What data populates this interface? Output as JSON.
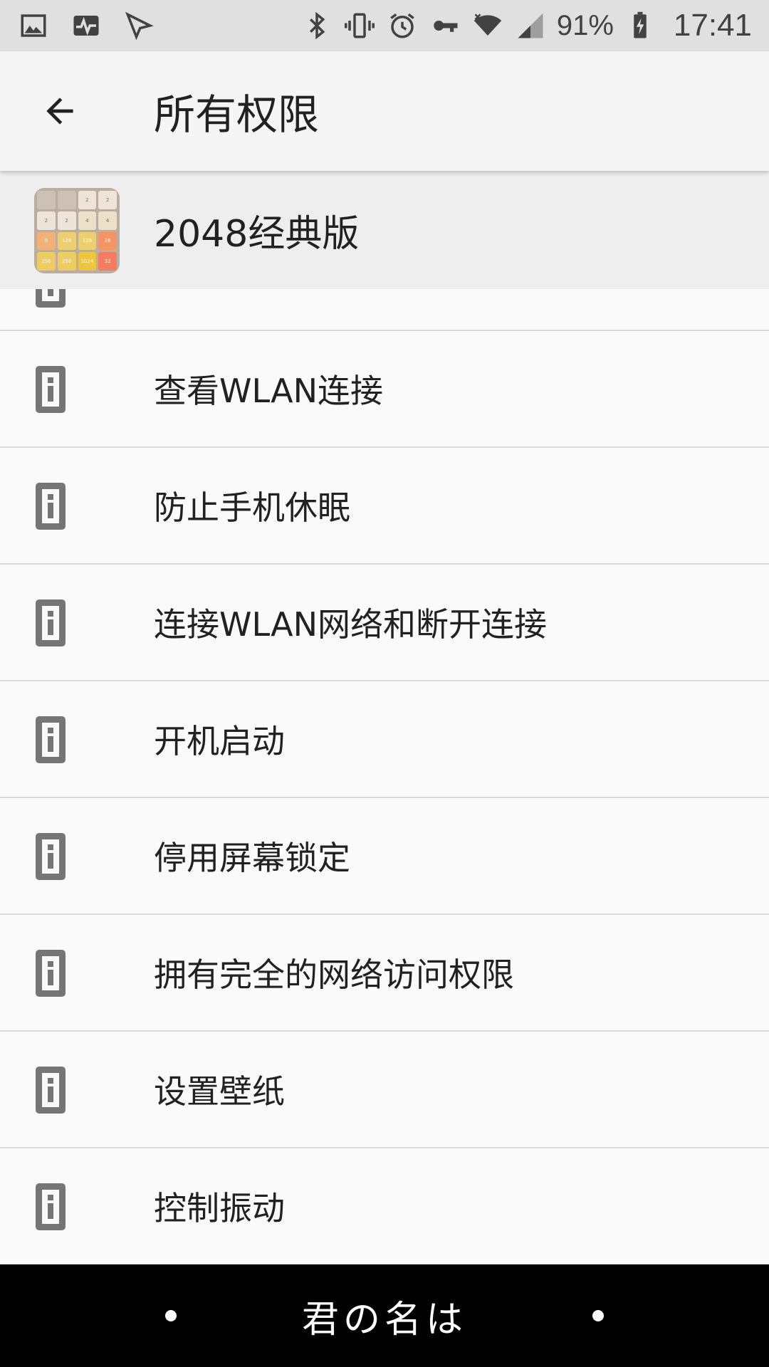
{
  "status_bar": {
    "left_icons": [
      "gallery-icon",
      "activity-icon",
      "send-icon"
    ],
    "right_icons": [
      "bluetooth-icon",
      "vibrate-icon",
      "alarm-icon",
      "vpn-key-icon",
      "wifi-icon",
      "signal-icon"
    ],
    "battery_percent": "91%",
    "time": "17:41"
  },
  "app_bar": {
    "title": "所有权限"
  },
  "app": {
    "name": "2048经典版",
    "icon_tiles": [
      "",
      "",
      "2",
      "2",
      "2",
      "2",
      "4",
      "4",
      "8",
      "128",
      "128",
      "16",
      "256",
      "256",
      "1024",
      "32"
    ]
  },
  "permissions": [
    {
      "label": "查看WLAN连接"
    },
    {
      "label": "防止手机休眠"
    },
    {
      "label": "连接WLAN网络和断开连接"
    },
    {
      "label": "开机启动"
    },
    {
      "label": "停用屏幕锁定"
    },
    {
      "label": "拥有完全的网络访问权限"
    },
    {
      "label": "设置壁纸"
    },
    {
      "label": "控制振动"
    }
  ],
  "bottom_bar": {
    "text": "君の名は"
  },
  "colors": {
    "status_bar_bg": "#e0e0e0",
    "app_bar_bg": "#f5f5f5",
    "app_row_bg": "#eeeeee",
    "list_bg": "#fafafa",
    "divider": "#dcdcdc",
    "icon_gray": "#757575",
    "bottom_bar_bg": "#000000"
  }
}
